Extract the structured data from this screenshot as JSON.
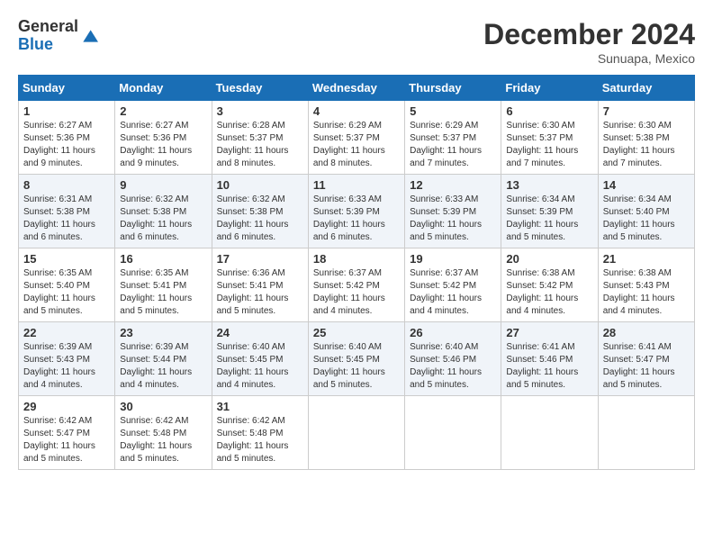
{
  "logo": {
    "general": "General",
    "blue": "Blue"
  },
  "title": "December 2024",
  "location": "Sunuapa, Mexico",
  "days_of_week": [
    "Sunday",
    "Monday",
    "Tuesday",
    "Wednesday",
    "Thursday",
    "Friday",
    "Saturday"
  ],
  "weeks": [
    [
      {
        "day": "1",
        "sunrise": "6:27 AM",
        "sunset": "5:36 PM",
        "daylight": "11 hours and 9 minutes."
      },
      {
        "day": "2",
        "sunrise": "6:27 AM",
        "sunset": "5:36 PM",
        "daylight": "11 hours and 9 minutes."
      },
      {
        "day": "3",
        "sunrise": "6:28 AM",
        "sunset": "5:37 PM",
        "daylight": "11 hours and 8 minutes."
      },
      {
        "day": "4",
        "sunrise": "6:29 AM",
        "sunset": "5:37 PM",
        "daylight": "11 hours and 8 minutes."
      },
      {
        "day": "5",
        "sunrise": "6:29 AM",
        "sunset": "5:37 PM",
        "daylight": "11 hours and 7 minutes."
      },
      {
        "day": "6",
        "sunrise": "6:30 AM",
        "sunset": "5:37 PM",
        "daylight": "11 hours and 7 minutes."
      },
      {
        "day": "7",
        "sunrise": "6:30 AM",
        "sunset": "5:38 PM",
        "daylight": "11 hours and 7 minutes."
      }
    ],
    [
      {
        "day": "8",
        "sunrise": "6:31 AM",
        "sunset": "5:38 PM",
        "daylight": "11 hours and 6 minutes."
      },
      {
        "day": "9",
        "sunrise": "6:32 AM",
        "sunset": "5:38 PM",
        "daylight": "11 hours and 6 minutes."
      },
      {
        "day": "10",
        "sunrise": "6:32 AM",
        "sunset": "5:38 PM",
        "daylight": "11 hours and 6 minutes."
      },
      {
        "day": "11",
        "sunrise": "6:33 AM",
        "sunset": "5:39 PM",
        "daylight": "11 hours and 6 minutes."
      },
      {
        "day": "12",
        "sunrise": "6:33 AM",
        "sunset": "5:39 PM",
        "daylight": "11 hours and 5 minutes."
      },
      {
        "day": "13",
        "sunrise": "6:34 AM",
        "sunset": "5:39 PM",
        "daylight": "11 hours and 5 minutes."
      },
      {
        "day": "14",
        "sunrise": "6:34 AM",
        "sunset": "5:40 PM",
        "daylight": "11 hours and 5 minutes."
      }
    ],
    [
      {
        "day": "15",
        "sunrise": "6:35 AM",
        "sunset": "5:40 PM",
        "daylight": "11 hours and 5 minutes."
      },
      {
        "day": "16",
        "sunrise": "6:35 AM",
        "sunset": "5:41 PM",
        "daylight": "11 hours and 5 minutes."
      },
      {
        "day": "17",
        "sunrise": "6:36 AM",
        "sunset": "5:41 PM",
        "daylight": "11 hours and 5 minutes."
      },
      {
        "day": "18",
        "sunrise": "6:37 AM",
        "sunset": "5:42 PM",
        "daylight": "11 hours and 4 minutes."
      },
      {
        "day": "19",
        "sunrise": "6:37 AM",
        "sunset": "5:42 PM",
        "daylight": "11 hours and 4 minutes."
      },
      {
        "day": "20",
        "sunrise": "6:38 AM",
        "sunset": "5:42 PM",
        "daylight": "11 hours and 4 minutes."
      },
      {
        "day": "21",
        "sunrise": "6:38 AM",
        "sunset": "5:43 PM",
        "daylight": "11 hours and 4 minutes."
      }
    ],
    [
      {
        "day": "22",
        "sunrise": "6:39 AM",
        "sunset": "5:43 PM",
        "daylight": "11 hours and 4 minutes."
      },
      {
        "day": "23",
        "sunrise": "6:39 AM",
        "sunset": "5:44 PM",
        "daylight": "11 hours and 4 minutes."
      },
      {
        "day": "24",
        "sunrise": "6:40 AM",
        "sunset": "5:45 PM",
        "daylight": "11 hours and 4 minutes."
      },
      {
        "day": "25",
        "sunrise": "6:40 AM",
        "sunset": "5:45 PM",
        "daylight": "11 hours and 5 minutes."
      },
      {
        "day": "26",
        "sunrise": "6:40 AM",
        "sunset": "5:46 PM",
        "daylight": "11 hours and 5 minutes."
      },
      {
        "day": "27",
        "sunrise": "6:41 AM",
        "sunset": "5:46 PM",
        "daylight": "11 hours and 5 minutes."
      },
      {
        "day": "28",
        "sunrise": "6:41 AM",
        "sunset": "5:47 PM",
        "daylight": "11 hours and 5 minutes."
      }
    ],
    [
      {
        "day": "29",
        "sunrise": "6:42 AM",
        "sunset": "5:47 PM",
        "daylight": "11 hours and 5 minutes."
      },
      {
        "day": "30",
        "sunrise": "6:42 AM",
        "sunset": "5:48 PM",
        "daylight": "11 hours and 5 minutes."
      },
      {
        "day": "31",
        "sunrise": "6:42 AM",
        "sunset": "5:48 PM",
        "daylight": "11 hours and 5 minutes."
      },
      null,
      null,
      null,
      null
    ]
  ],
  "labels": {
    "sunrise": "Sunrise:",
    "sunset": "Sunset:",
    "daylight": "Daylight:"
  }
}
